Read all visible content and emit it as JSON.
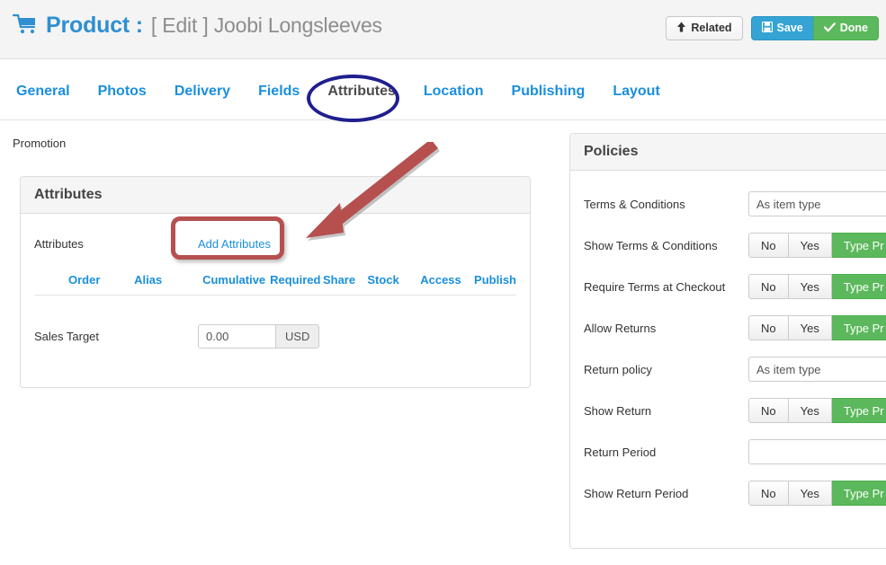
{
  "header": {
    "icon": "shopping-cart-icon",
    "title_main": "Product :",
    "title_sub": "[ Edit ] Joobi Longsleeves",
    "buttons": {
      "related": "Related",
      "save": "Save",
      "done": "Done"
    }
  },
  "tabs": [
    {
      "label": "General",
      "active": false
    },
    {
      "label": "Photos",
      "active": false
    },
    {
      "label": "Delivery",
      "active": false
    },
    {
      "label": "Fields",
      "active": false
    },
    {
      "label": "Attributes",
      "active": true
    },
    {
      "label": "Location",
      "active": false
    },
    {
      "label": "Publishing",
      "active": false
    },
    {
      "label": "Layout",
      "active": false
    }
  ],
  "content": {
    "promotion_label": "Promotion"
  },
  "attributes_panel": {
    "heading": "Attributes",
    "row_label": "Attributes",
    "add_link": "Add Attributes",
    "columns": [
      "Order",
      "Alias",
      "Cumulative",
      "Required",
      "Share",
      "Stock",
      "Access",
      "Publish"
    ],
    "sales_target": {
      "label": "Sales Target",
      "value": "0.00",
      "currency": "USD"
    }
  },
  "policies_panel": {
    "heading": "Policies",
    "rows": [
      {
        "label": "Terms & Conditions",
        "control": "select",
        "value": "As item type"
      },
      {
        "label": "Show Terms & Conditions",
        "control": "buttons",
        "options": [
          "No",
          "Yes",
          "Type Pr"
        ],
        "selected": 2
      },
      {
        "label": "Require Terms at Checkout",
        "control": "buttons",
        "options": [
          "No",
          "Yes",
          "Type Pr"
        ],
        "selected": 2
      },
      {
        "label": "Allow Returns",
        "control": "buttons",
        "options": [
          "No",
          "Yes",
          "Type Pr"
        ],
        "selected": 2
      },
      {
        "label": "Return policy",
        "control": "select",
        "value": "As item type"
      },
      {
        "label": "Show Return",
        "control": "buttons",
        "options": [
          "No",
          "Yes",
          "Type Pr"
        ],
        "selected": 2
      },
      {
        "label": "Return Period",
        "control": "input",
        "value": ""
      },
      {
        "label": "Show Return Period",
        "control": "buttons",
        "options": [
          "No",
          "Yes",
          "Type Pr"
        ],
        "selected": 2
      }
    ]
  },
  "annotations": {
    "ellipse_color": "#1f1f8f",
    "highlight_color": "#b5504f",
    "arrow_color": "#b5504f"
  },
  "colors": {
    "link_blue": "#1a8fdd",
    "title_blue": "#2f8fd0",
    "save_blue": "#35a4d4",
    "done_green": "#5cb85c"
  }
}
